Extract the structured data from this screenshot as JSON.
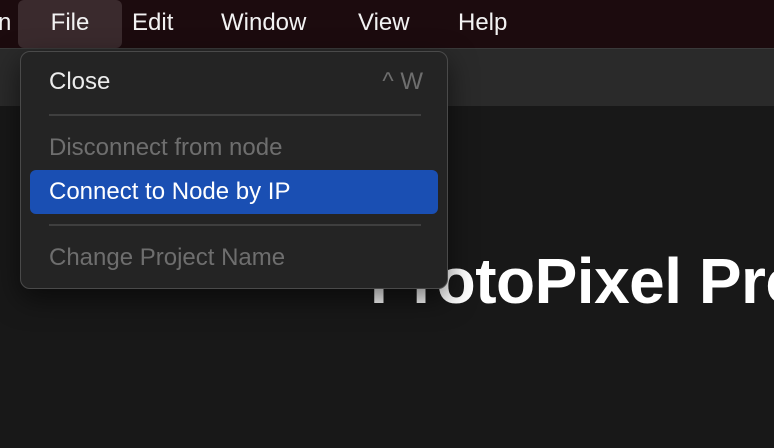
{
  "menubar": {
    "app_label": "n",
    "items": [
      "File",
      "Edit",
      "Window",
      "View",
      "Help"
    ]
  },
  "file_menu": {
    "close_label": "Close",
    "close_shortcut": "^ W",
    "disconnect_label": "Disconnect from node",
    "connect_label": "Connect to Node by IP",
    "rename_label": "Change Project Name"
  },
  "main": {
    "title": "ProtoPixel Pro"
  },
  "colors": {
    "menubar_bg": "#1c0b0e",
    "highlight": "#1a4fb3",
    "menu_bg": "#242424",
    "content_bg": "#181818"
  }
}
